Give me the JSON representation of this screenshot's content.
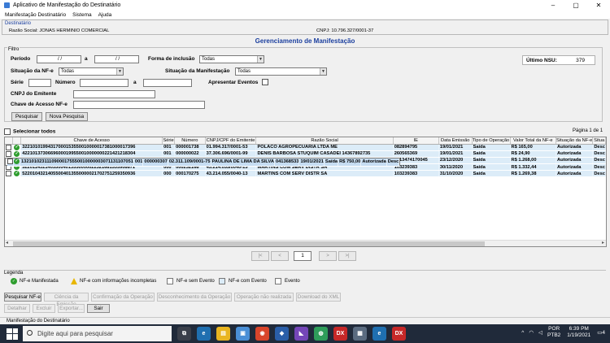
{
  "window": {
    "title": "Aplicativo de Manifestação do Destinatário",
    "controls": [
      "–",
      "▢",
      "✕"
    ]
  },
  "menu": [
    "Manifestação Destinatário",
    "Sistema",
    "Ajuda"
  ],
  "destinatario": {
    "label": "Destinatário",
    "razao_social": "Razão Social:  JONAS HERMINIO COMERCIAL",
    "cnpj": "CNPJ:  10.796.327/0001-37"
  },
  "page_title": "Gerenciamento de Manifestação",
  "filtro": {
    "legend": "Filtro",
    "periodo_label": "Período",
    "periodo_from": "/ /",
    "periodo_to_label": "a",
    "periodo_to": "/ /",
    "forma_label": "Forma de inclusão",
    "forma_value": "Todas",
    "ultimo_nsu_label": "Último NSU:",
    "ultimo_nsu_value": "379",
    "situacao_nfe_label": "Situação da NF-e",
    "situacao_nfe_value": "Todas",
    "situacao_manif_label": "Situação da Manifestação",
    "situacao_manif_value": "Todas",
    "serie_label": "Série",
    "numero_label": "Número",
    "numero_to_label": "a",
    "apresentar_label": "Apresentar Eventos",
    "cnpj_emitente_label": "CNPJ do Emitente",
    "chave_label": "Chave de Acesso NF-e",
    "pesquisar": "Pesquisar",
    "nova_pesquisa": "Nova Pesquisa"
  },
  "selecionar_todos": "Selecionar todos",
  "pagina": "Página 1 de 1",
  "grid": {
    "columns": [
      "",
      "",
      "Chave de Acesso",
      "Série",
      "Número",
      "CNPJ/CPF do Emitente",
      "Razão Social",
      "IE",
      "Data Emissão",
      "Tipo de Operação",
      "Valor Total da NF-e",
      "Situação da NF-e",
      "Situa"
    ],
    "rows": [
      [
        "32210101994317000153550010000017381000017396",
        "001",
        "000001738",
        "01.994.317/0001-53",
        "POLACO AGROPECUARIA LTDA ME",
        "082894795",
        "19/01/2021",
        "Saída",
        "R$ 165,00",
        "Autorizada",
        "Desc"
      ],
      [
        "42210137306696000199550010000000221421218304",
        "001",
        "000000022",
        "37.306.696/0001-99",
        "DENIS BARBOSA STUQUIM CASADEI 14367892735",
        "260565369",
        "19/01/2021",
        "Saída",
        "R$ 24,90",
        "Autorizada",
        "Desc"
      ],
      [
        "13210102311109000175550010000003071131107051",
        "001",
        "000000307",
        "02.311.109/0001-75",
        "PAULINA DE LIMA DA SILVA",
        "041368533",
        "19/01/2021",
        "Saída",
        "R$ 750,00",
        "Autorizada",
        "Desc"
      ],
      [
        "31201259717553000617550020026154381100117880",
        "002",
        "002615438",
        "59.717.553/0006-17",
        "MULTILASER INDUSTRIAL S.A.",
        "2513474170045",
        "23/12/2020",
        "Saída",
        "R$ 1.268,00",
        "Autorizada",
        "Desc"
      ],
      [
        "52201143214055004013550000022321681535908871",
        "000",
        "000232168",
        "43.214.055/0040-13",
        "MARTINS COM SERV DISTR SA",
        "103239383",
        "30/11/2020",
        "Saída",
        "R$ 1.332,44",
        "Autorizada",
        "Desc"
      ],
      [
        "52201043214055004013550000021702751259350936",
        "000",
        "000170275",
        "43.214.055/0040-13",
        "MARTINS COM SERV DISTR SA",
        "103239383",
        "31/10/2020",
        "Saída",
        "R$ 1.269,38",
        "Autorizada",
        "Desc"
      ]
    ]
  },
  "pager": {
    "first": "|<",
    "prev": "<",
    "page": "1",
    "next": ">",
    "last": ">|"
  },
  "legenda": {
    "title": "Legenda",
    "items": [
      "NF-e Manifestada",
      "NF-e com informações incompletas",
      "NF-e sem Evento",
      "NF-e com Evento",
      "Evento"
    ],
    "colors": [
      "#2e9d2e",
      "#e8b600",
      "#ffffff",
      "#dcecf8",
      "#ffffff"
    ]
  },
  "actions_row1": [
    "Pesquisar NF-e",
    "Ciência da Emissão",
    "Confirmação da Operação",
    "Desconhecimento da Operação",
    "Operação não realizada",
    "Download do XML"
  ],
  "actions_row2": [
    "Detalhar",
    "Excluir",
    "Exportar...",
    "Sair"
  ],
  "status": "Manifestação do Destinatário",
  "taskbar": {
    "search_placeholder": "Digite aqui para pesquisar",
    "lang1": "POR",
    "lang2": "PTB2",
    "time": "6:39 PM",
    "date": "1/19/2021",
    "notif": "4"
  }
}
